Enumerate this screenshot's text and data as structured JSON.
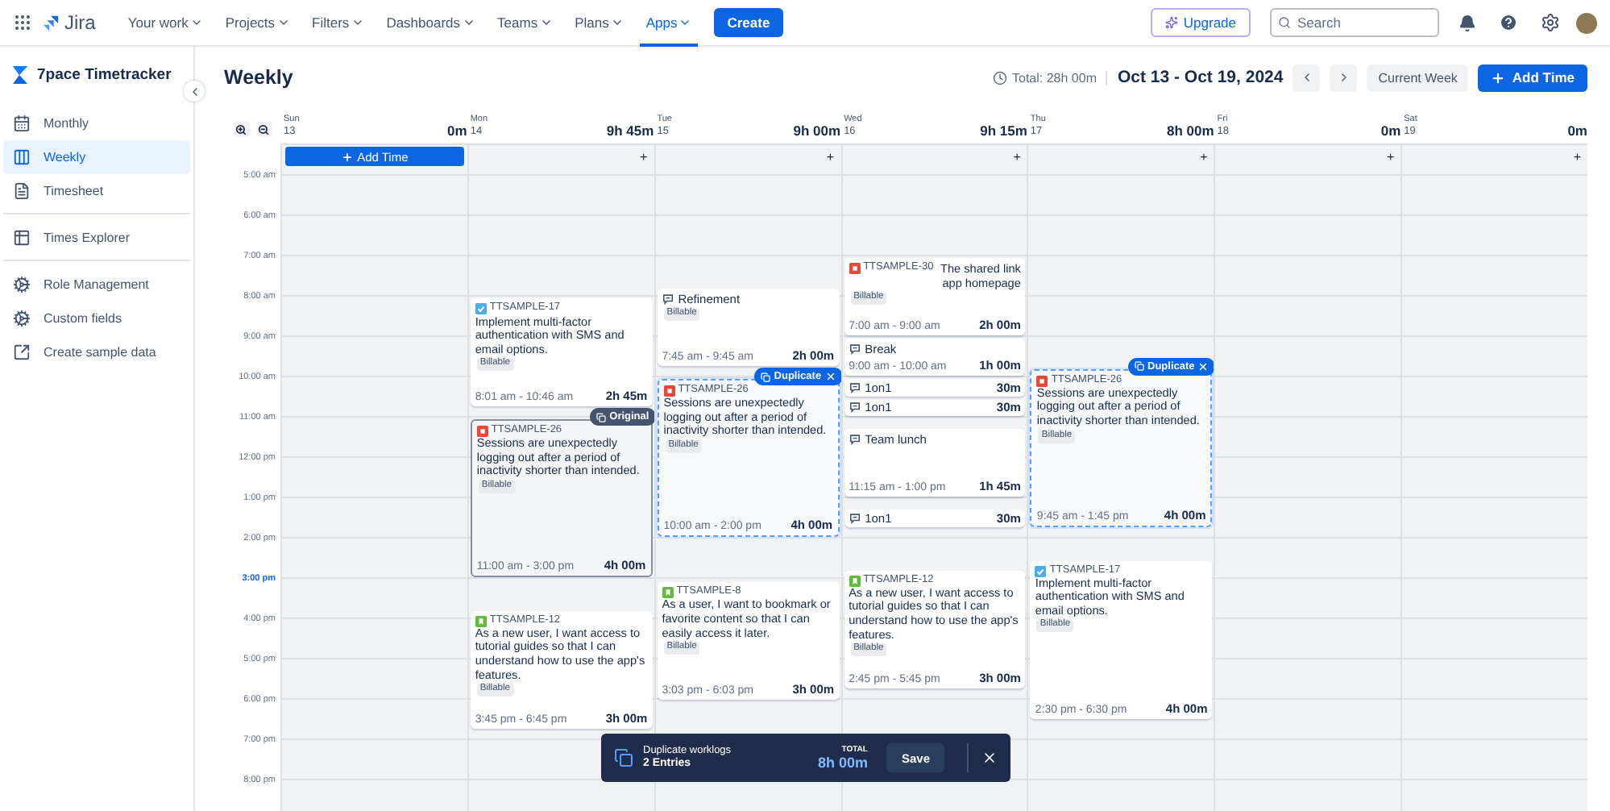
{
  "nav": {
    "product": "Jira",
    "items": [
      {
        "label": "Your work",
        "selected": false
      },
      {
        "label": "Projects",
        "selected": false
      },
      {
        "label": "Filters",
        "selected": false
      },
      {
        "label": "Dashboards",
        "selected": false
      },
      {
        "label": "Teams",
        "selected": false
      },
      {
        "label": "Plans",
        "selected": false
      },
      {
        "label": "Apps",
        "selected": true
      }
    ],
    "create": "Create",
    "upgrade": "Upgrade",
    "search": {
      "placeholder": "Search"
    }
  },
  "sidebar": {
    "title": "7pace Timetracker",
    "groups": [
      {
        "items": [
          {
            "label": "Monthly",
            "selected": false
          },
          {
            "label": "Weekly",
            "selected": true
          },
          {
            "label": "Timesheet",
            "selected": false
          }
        ]
      },
      {
        "items": [
          {
            "label": "Times Explorer",
            "selected": false
          }
        ]
      },
      {
        "items": [
          {
            "label": "Role Management",
            "selected": false
          },
          {
            "label": "Custom fields",
            "selected": false
          },
          {
            "label": "Create sample data",
            "selected": false
          }
        ]
      }
    ]
  },
  "header": {
    "title": "Weekly",
    "total": "Total: 28h 00m",
    "range": "Oct 13 - Oct 19, 2024",
    "current_week": "Current Week",
    "add_time": "Add Time"
  },
  "hours": [
    {
      "label": "5:00 am",
      "current": false
    },
    {
      "label": "6:00 am",
      "current": false
    },
    {
      "label": "7:00 am",
      "current": false
    },
    {
      "label": "8:00 am",
      "current": false
    },
    {
      "label": "9:00 am",
      "current": false
    },
    {
      "label": "10:00 am",
      "current": false
    },
    {
      "label": "11:00 am",
      "current": false
    },
    {
      "label": "12:00 pm",
      "current": false
    },
    {
      "label": "1:00 pm",
      "current": false
    },
    {
      "label": "2:00 pm",
      "current": false
    },
    {
      "label": "3:00 pm",
      "current": true
    },
    {
      "label": "4:00 pm",
      "current": false
    },
    {
      "label": "5:00 pm",
      "current": false
    },
    {
      "label": "6:00 pm",
      "current": false
    },
    {
      "label": "7:00 pm",
      "current": false
    },
    {
      "label": "8:00 pm",
      "current": false
    }
  ],
  "days": [
    {
      "name": "Sun",
      "date": "13",
      "total": "0m",
      "add": {
        "kind": "button",
        "label": "Add Time"
      }
    },
    {
      "name": "Mon",
      "date": "14",
      "total": "9h 45m",
      "add": {
        "kind": "plus",
        "label": "+"
      },
      "events": [
        {
          "kind": "task",
          "key": "TTSAMPLE-17",
          "summary": "Implement multi-factor authentication with SMS and email options.",
          "tag": "Billable",
          "time": "8:01 am - 10:46 am",
          "duration": "2h 45m"
        },
        {
          "kind": "bug",
          "key": "TTSAMPLE-26",
          "summary": "Sessions are unexpectedly logging out after a period of inactivity shorter than intended.",
          "tag": "Billable",
          "time": "11:00 am - 3:00 pm",
          "duration": "4h 00m",
          "badge": {
            "kind": "original",
            "label": "Original"
          }
        },
        {
          "kind": "story",
          "key": "TTSAMPLE-12",
          "summary": "As a new user, I want access to tutorial guides so that I can understand how to use the app's features.",
          "tag": "Billable",
          "time": "3:45 pm - 6:45 pm",
          "duration": "3h 00m"
        }
      ]
    },
    {
      "name": "Tue",
      "date": "15",
      "total": "9h 00m",
      "add": {
        "kind": "plus",
        "label": "+"
      },
      "events": [
        {
          "kind": "activity",
          "name": "Refinement",
          "tag": "Billable",
          "time": "7:45 am - 9:45 am",
          "duration": "2h 00m"
        },
        {
          "kind": "bug",
          "key": "TTSAMPLE-26",
          "summary": "Sessions are unexpectedly logging out after a period of inactivity shorter than intended.",
          "tag": "Billable",
          "time": "10:00 am - 2:00 pm",
          "duration": "4h 00m",
          "badge": {
            "kind": "duplicate",
            "label": "Duplicate"
          }
        },
        {
          "kind": "story",
          "key": "TTSAMPLE-8",
          "summary": "As a user, I want to bookmark or favorite content so that I can easily access it later.",
          "tag": "Billable",
          "time": "3:03 pm - 6:03 pm",
          "duration": "3h 00m"
        }
      ]
    },
    {
      "name": "Wed",
      "date": "16",
      "total": "9h 15m",
      "add": {
        "kind": "plus",
        "label": "+"
      },
      "events": [
        {
          "kind": "bug",
          "key": "TTSAMPLE-30",
          "summary": "The shared link app homepage",
          "tag": "Billable",
          "time": "7:00 am - 9:00 am",
          "duration": "2h 00m",
          "compact": true
        },
        {
          "kind": "activity",
          "name": "Break",
          "time": "9:00 am - 10:00 am",
          "duration": "1h 00m"
        },
        {
          "kind": "activity",
          "name": "1on1",
          "duration": "30m"
        },
        {
          "kind": "activity",
          "name": "1on1",
          "duration": "30m"
        },
        {
          "kind": "activity",
          "name": "Team lunch",
          "time": "11:15 am - 1:00 pm",
          "duration": "1h 45m"
        },
        {
          "kind": "activity",
          "name": "1on1",
          "duration": "30m"
        },
        {
          "kind": "story",
          "key": "TTSAMPLE-12",
          "summary": "As a new user, I want access to tutorial guides so that I can understand how to use the app's features.",
          "tag": "Billable",
          "time": "2:45 pm - 5:45 pm",
          "duration": "3h 00m"
        }
      ]
    },
    {
      "name": "Thu",
      "date": "17",
      "total": "8h 00m",
      "add": {
        "kind": "plus",
        "label": "+"
      },
      "events": [
        {
          "kind": "bug",
          "key": "TTSAMPLE-26",
          "summary": "Sessions are unexpectedly logging out after a period of inactivity shorter than intended.",
          "tag": "Billable",
          "time": "9:45 am - 1:45 pm",
          "duration": "4h 00m",
          "badge": {
            "kind": "duplicate",
            "label": "Duplicate"
          }
        },
        {
          "kind": "task",
          "key": "TTSAMPLE-17",
          "summary": "Implement multi-factor authentication with SMS and email options.",
          "tag": "Billable",
          "time": "2:30 pm - 6:30 pm",
          "duration": "4h 00m"
        }
      ]
    },
    {
      "name": "Fri",
      "date": "18",
      "total": "0m",
      "add": {
        "kind": "plus",
        "label": "+"
      }
    },
    {
      "name": "Sat",
      "date": "19",
      "total": "0m",
      "add": {
        "kind": "plus",
        "label": "+"
      }
    }
  ],
  "duplicate_bar": {
    "title": "Duplicate worklogs",
    "entries": "2 Entries",
    "total_label": "TOTAL",
    "total": "8h 00m",
    "save": "Save"
  }
}
